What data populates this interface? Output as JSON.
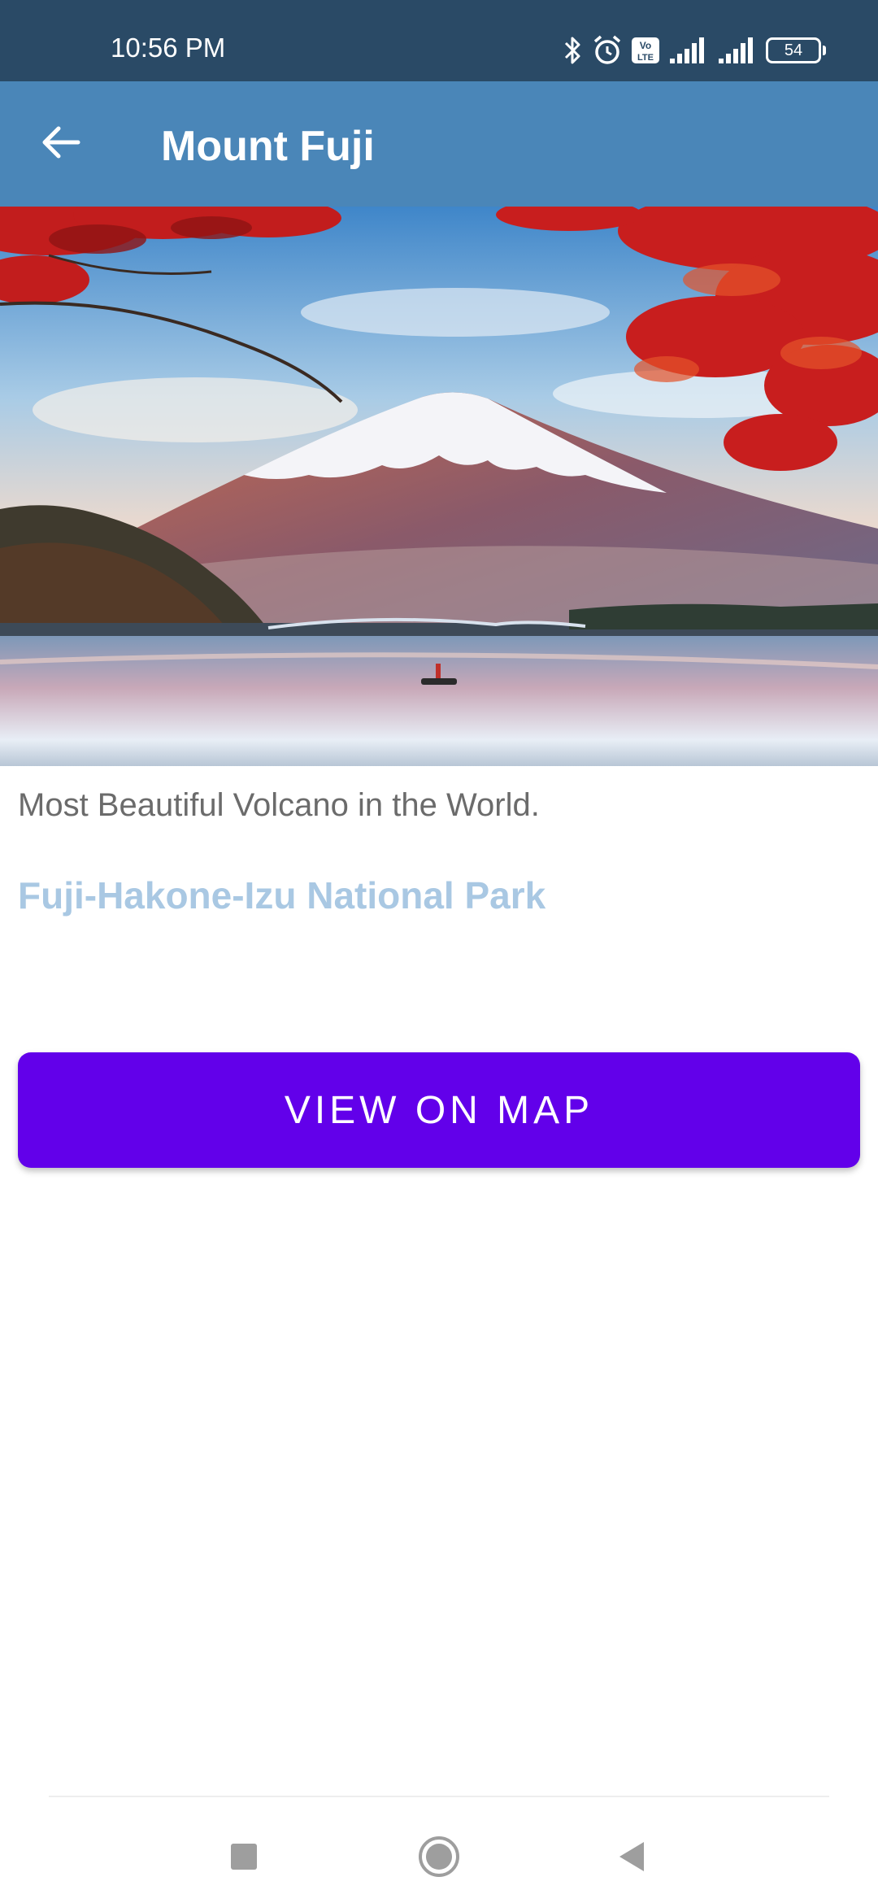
{
  "status_bar": {
    "time": "10:56 PM",
    "battery": "54",
    "volte_label": "Vo LTE",
    "icons": [
      "bluetooth-icon",
      "alarm-icon",
      "volte-icon",
      "signal-icon",
      "signal-icon",
      "battery-icon"
    ]
  },
  "app_bar": {
    "title": "Mount Fuji",
    "back_icon": "arrow-back-icon",
    "color": "#4a86b8"
  },
  "content": {
    "subtitle": "Most Beautiful Volcano in the World.",
    "park_name": "Fuji-Hakone-Izu National Park",
    "map_button_label": "VIEW ON MAP",
    "map_button_color": "#6200ea",
    "park_color": "#a9c8e3"
  },
  "nav_bar": {
    "icons": [
      "recents-square-icon",
      "home-circle-icon",
      "back-triangle-icon"
    ]
  }
}
